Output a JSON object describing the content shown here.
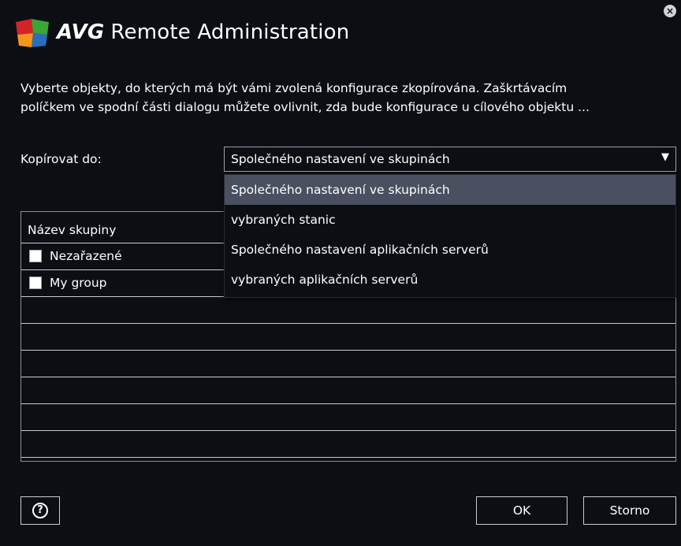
{
  "window": {
    "brand": "AVG",
    "title": "Remote Administration",
    "close_glyph": "×"
  },
  "description": {
    "line1": "Vyberte objekty, do kterých má být vámi zvolená konfigurace zkopírována. Zaškrtávacím",
    "line2": "políčkem ve spodní části dialogu můžete ovlivnit, zda bude konfigurace u cílového objektu ..."
  },
  "copy_to": {
    "label": "Kopírovat do:",
    "selected": "Společného nastavení ve skupinách",
    "arrow_glyph": "▼",
    "options": [
      "Společného nastavení ve skupinách",
      "vybraných stanic",
      "Společného nastavení aplikačních serverů",
      "vybraných aplikačních serverů"
    ]
  },
  "table": {
    "column_header": "Název skupiny",
    "rows": [
      {
        "label": "Nezařazené",
        "checked": false
      },
      {
        "label": "My group",
        "checked": false
      }
    ]
  },
  "footer": {
    "help_glyph": "?",
    "ok_label": "OK",
    "cancel_label": "Storno"
  },
  "colors": {
    "background": "#0d0e13",
    "selected_option": "#4a5060",
    "border": "#c8ccd3",
    "logo_green": "#3aa635",
    "logo_red": "#d2232a",
    "logo_orange": "#f7941d",
    "logo_blue": "#2a6ebb"
  },
  "icons": {
    "logo": "avg-logo",
    "close": "close-icon",
    "help": "help-icon",
    "dropdown": "chevron-down-icon"
  }
}
